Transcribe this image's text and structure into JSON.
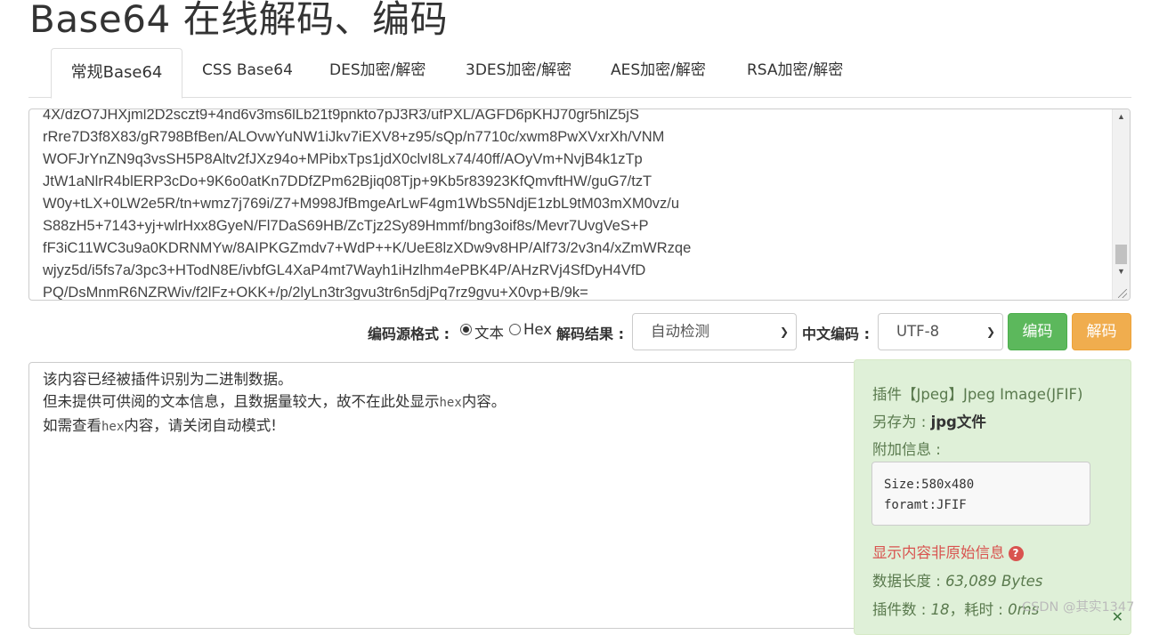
{
  "header": {
    "title": "Base64 在线解码、编码"
  },
  "tabs": [
    {
      "label": "常规Base64"
    },
    {
      "label": "CSS Base64"
    },
    {
      "label": "DES加密/解密"
    },
    {
      "label": "3DES加密/解密"
    },
    {
      "label": "AES加密/解密"
    },
    {
      "label": "RSA加密/解密"
    }
  ],
  "input": {
    "lines": [
      "4X/dzO7JHXjml2D2sczt9+4nd6v3ms6lLb21t9pnkto7pJ3R3/ufPXL/AGFD6pKHJ70gr5hlZ5jS",
      "rRre7D3f8X83/gR798BfBen/ALOvwYuNW1iJkv7iEXV8+z95/sQp/n7710c/xwm8PwXVxrXh/VNM",
      "WOFJrYnZN9q3vsSH5P8Altv2fJXz94o+MPibxTps1jdX0clvI8Lx74/40ff/AOyVm+NvjB4k1zTp",
      "JtW1aNlrR4blERP3cDo+9K6o0atKn7DDfZPm62Bjiq08Tjp+9Kb5r83923KfQmvftHW/guG7/tzT",
      "W0y+tLX+0LW2e5R/tn+wmz7j769i/Z7+M998JfBmgeArLwF4gm1WbS5NdjE1zbL9tM03mXM0vz/u",
      "S88zH5+7143+yj+wlrHxx8GyeN/Fl7DaS69HB/ZcTjz2Sy89Hmmf/bng3oif8s/Mevr7UvgVeS+P",
      "fF3iC11WC3u9a0KDRNMYw/8AIPKGZmdv7+WdP++K/UeE8lzXDw9v8HP/Alf73/2v3n4/xZmWRzqe",
      "wjyz5d/i5fs7a/3pc3+HTodN8E/ivbfGL4XaP4mt7Wayh1iHzlhm4ePBK4P/AHzRVj4SfDyH4VfD",
      "PQ/DsMnmR6NZRWiv/f2lFz+OKK+/p/2lyLn3tr3gvu3tr6n5djPq7rz9gvu+X0vp+B/9k="
    ]
  },
  "controls": {
    "source_format_label": "编码源格式 :",
    "option_text": "文本",
    "option_hex": "Hex",
    "decode_result_label": "解码结果 :",
    "decode_result_value": "自动检测",
    "charset_label": "中文编码 :",
    "charset_value": "UTF-8",
    "encode_button": "编码",
    "decode_button": "解码"
  },
  "output": {
    "line1": "该内容已经被插件识别为二进制数据。",
    "line2_pre": "但未提供可供阅的文本信息，且数据量较大，故不在此处显示",
    "hex_word": "hex",
    "line2_post": "内容。",
    "line3_pre": "如需查看",
    "line3_post": "内容，请关闭自动模式!"
  },
  "info": {
    "plugin_line": "插件【Jpeg】Jpeg Image(JFIF)",
    "save_as_label": "另存为 : ",
    "save_as_value": "jpg文件",
    "extra_label": "附加信息 :",
    "extra_lines": [
      "Size:580x480",
      "foramt:JFIF"
    ],
    "warning": "显示内容非原始信息",
    "length_label": "数据长度 : ",
    "length_value": "63,089 Bytes",
    "plugins_label": "插件数 : ",
    "plugins_value": "18",
    "time_label": "，耗时 : ",
    "time_value": "0ms"
  },
  "watermark": "CSDN @其实1347"
}
